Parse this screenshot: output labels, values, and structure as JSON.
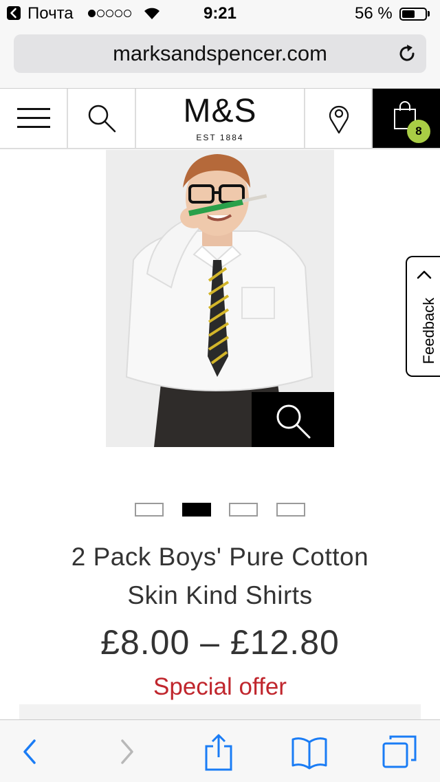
{
  "status_bar": {
    "carrier": "Почта",
    "time": "9:21",
    "battery_percent_text": "56 %",
    "battery_level": 0.56,
    "signal_bars_filled": 1,
    "signal_bars_total": 5
  },
  "browser": {
    "url": "marksandspencer.com"
  },
  "site_header": {
    "logo": "M&S",
    "logo_subtitle": "EST 1884",
    "bag_count": "8",
    "badge_color": "#a9cd45"
  },
  "feedback": {
    "label": "Feedback"
  },
  "carousel": {
    "total": 4,
    "active_index": 1
  },
  "product": {
    "title_line1": "2 Pack Boys' Pure Cotton",
    "title_line2": "Skin Kind Shirts",
    "price": "£8.00 – £12.80",
    "offer": "Special offer",
    "offer_color": "#c0262d"
  },
  "icons": {
    "menu": "hamburger-icon",
    "search": "search-icon",
    "store_locator": "location-pin-icon",
    "bag": "shopping-bag-icon",
    "zoom": "zoom-icon",
    "toolbar": [
      "back-icon",
      "forward-icon",
      "share-icon",
      "bookmarks-icon",
      "tabs-icon"
    ]
  },
  "accent_color": "#1a7cf5"
}
